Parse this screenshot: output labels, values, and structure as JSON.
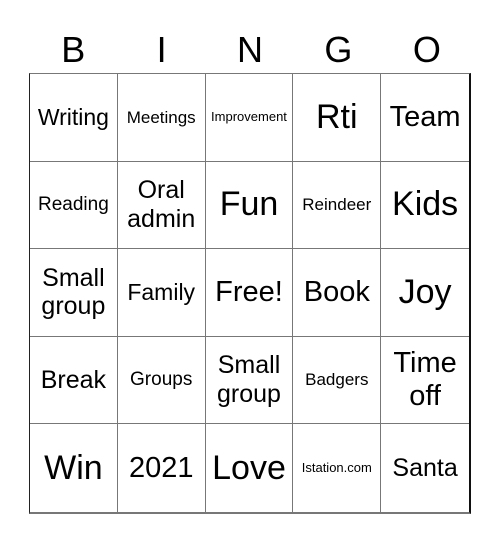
{
  "header": [
    "B",
    "I",
    "N",
    "G",
    "O"
  ],
  "cells": [
    [
      "Writing",
      "Meetings",
      "Improvement",
      "Rti",
      "Team"
    ],
    [
      "Reading",
      "Oral admin",
      "Fun",
      "Reindeer",
      "Kids"
    ],
    [
      "Small group",
      "Family",
      "Free!",
      "Book",
      "Joy"
    ],
    [
      "Break",
      "Groups",
      "Small group",
      "Badgers",
      "Time off"
    ],
    [
      "Win",
      "2021",
      "Love",
      "Istation.com",
      "Santa"
    ]
  ]
}
